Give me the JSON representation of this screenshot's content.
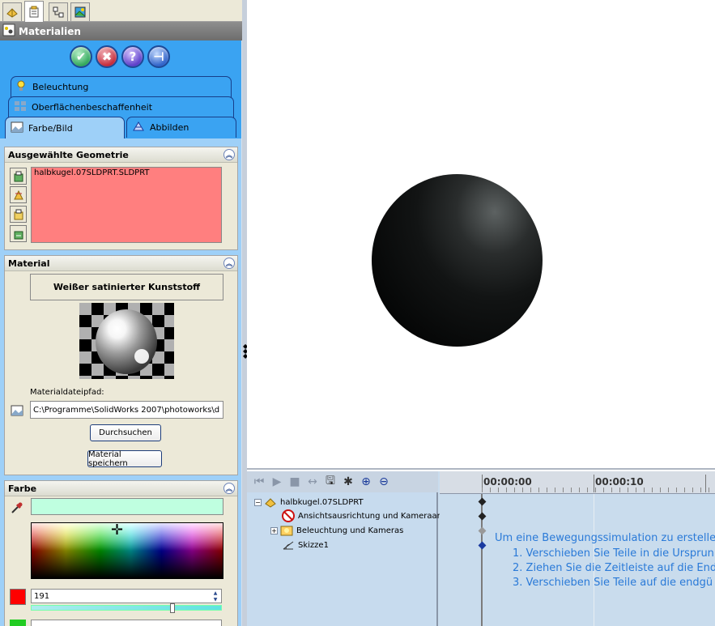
{
  "feature_manager": {
    "tabs": [
      {
        "name": "feature-tree-tab",
        "icon": "part-tree-icon"
      },
      {
        "name": "property-manager-tab",
        "icon": "property-manager-icon"
      },
      {
        "name": "configuration-tab",
        "icon": "configuration-icon"
      },
      {
        "name": "photoworks-tab",
        "icon": "render-icon"
      }
    ]
  },
  "property_manager": {
    "title": "Materialien",
    "buttons": {
      "ok": "✔",
      "cancel": "✖",
      "help": "?",
      "pin": "⊣"
    },
    "tabs": [
      {
        "label": "Beleuchtung"
      },
      {
        "label": "Oberflächenbeschaffenheit"
      },
      {
        "label": "Farbe/Bild"
      },
      {
        "label": "Abbilden"
      }
    ]
  },
  "geometry": {
    "title": "Ausgewählte Geometrie",
    "items": [
      "halbkugel.07SLDPRT.SLDPRT"
    ]
  },
  "material": {
    "title": "Material",
    "name": "Weißer satinierter Kunststoff",
    "path_label": "Materialdateipfad:",
    "path_value": "C:\\Programme\\SolidWorks 2007\\photoworks\\d",
    "browse_label": "Durchsuchen",
    "save_label": "Material speichern"
  },
  "color": {
    "title": "Farbe",
    "swatch": "#bfffe0",
    "red_value": "191",
    "red_color": "#ff0000",
    "green_color": "#22cc22"
  },
  "animator": {
    "tree": [
      {
        "label": "halbkugel.07SLDPRT",
        "expander": "−",
        "icon": "part-icon"
      },
      {
        "label": "Ansichtsausrichtung und Kameraan",
        "icon": "no-view-icon"
      },
      {
        "label": "Beleuchtung und Kameras",
        "expander": "+",
        "icon": "lights-icon"
      },
      {
        "label": "Skizze1",
        "icon": "sketch-icon"
      }
    ],
    "timeline_labels": [
      "00:00:00",
      "00:00:10"
    ],
    "tips": [
      "Um eine Bewegungssimulation zu erstelle",
      "1. Verschieben Sie Teile in die Ursprun",
      "2. Ziehen Sie die Zeitleiste auf die End",
      "3. Verschieben Sie Teile auf die endgü"
    ]
  }
}
